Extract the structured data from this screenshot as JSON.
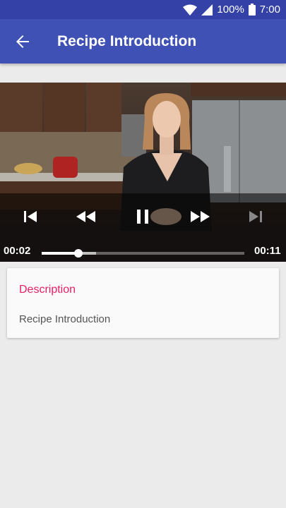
{
  "status_bar": {
    "battery": "100%",
    "time": "7:00",
    "icons": [
      "wifi-icon",
      "cell-signal-icon",
      "battery-icon"
    ]
  },
  "app_bar": {
    "title": "Recipe Introduction",
    "back_icon": "arrow-back-icon",
    "color": "#3f51b5"
  },
  "player": {
    "controls": [
      "skip-previous-icon",
      "rewind-icon",
      "pause-icon",
      "fast-forward-icon",
      "skip-next-icon"
    ],
    "position": "00:02",
    "duration": "00:11",
    "progress": 0.18,
    "buffered": 0.27
  },
  "description": {
    "heading": "Description",
    "text": "Recipe Introduction",
    "accent": "#e91e63"
  }
}
